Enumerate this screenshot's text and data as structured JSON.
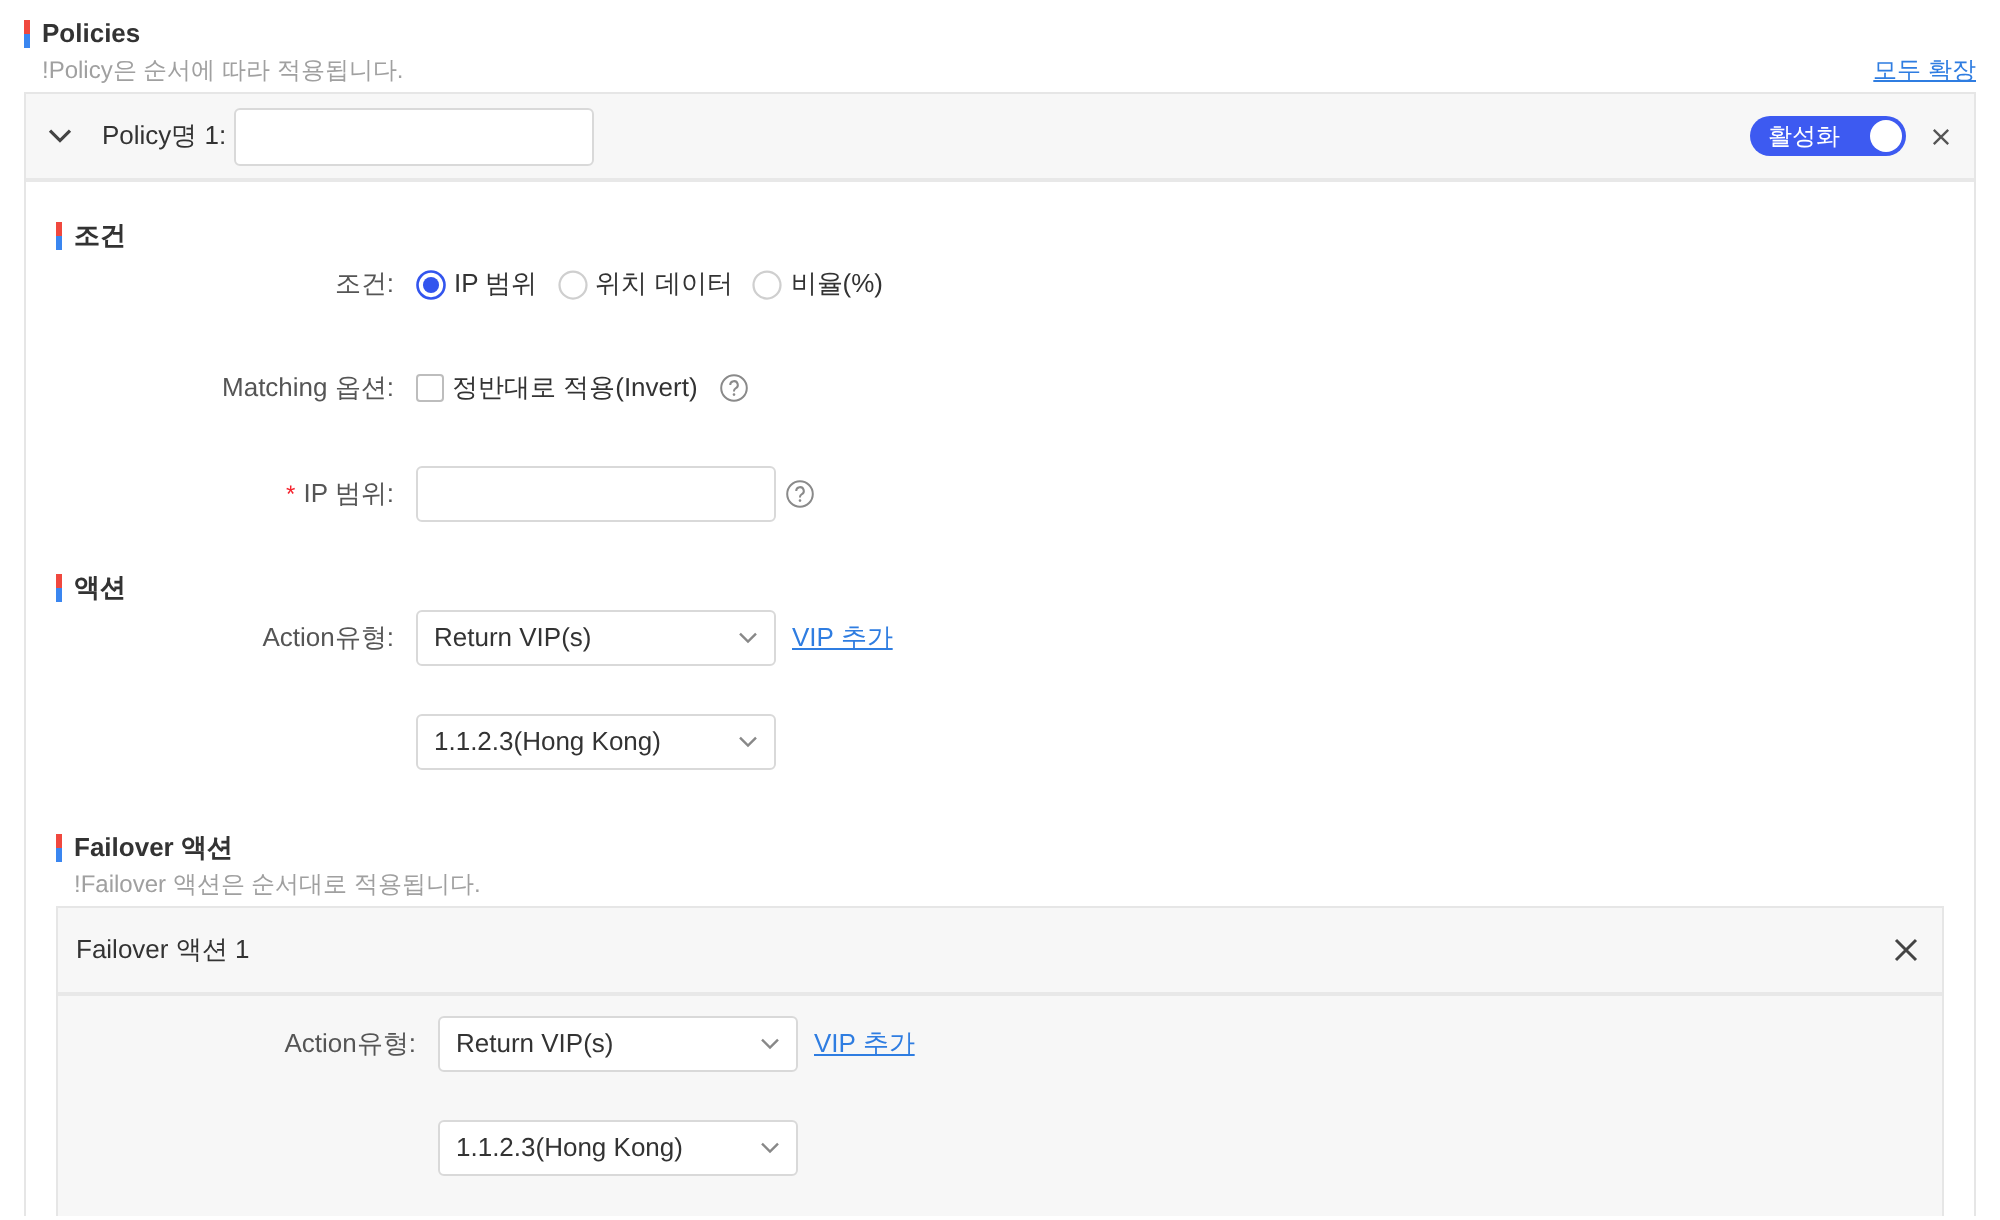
{
  "section": {
    "title": "Policies",
    "note": "!Policy은 순서에 따라 적용됩니다.",
    "expand_all_link": "모두 확장"
  },
  "policies": [
    {
      "expanded": true,
      "name_label": "Policy명 1:",
      "toggle": {
        "label": "활성화",
        "on": true
      },
      "condition": {
        "title": "조건",
        "condition_field": {
          "label": "조건:",
          "options": [
            {
              "label": "IP 범위",
              "selected": true
            },
            {
              "label": "위치 데이터",
              "selected": false
            },
            {
              "label": "비율(%)",
              "selected": false
            }
          ]
        },
        "matching_field": {
          "label": "Matching 옵션:",
          "checkbox": {
            "label": "정반대로 적용(Invert)",
            "checked": false
          },
          "help": true
        },
        "ip_range_field": {
          "required_mark": "*",
          "label": "IP 범위:",
          "help": true
        }
      },
      "action": {
        "title": "액션",
        "action_type_field": {
          "label": "Action유형:",
          "value": "Return VIP(s)"
        },
        "add_vip_link": "VIP 추가",
        "vip_select": {
          "value": "1.1.2.3(Hong Kong)"
        }
      },
      "failover": {
        "title": "Failover 액션",
        "note": "!Failover 액션은 순서대로 적용됩니다.",
        "actions": [
          {
            "title": "Failover 액션 1",
            "action_type_field": {
              "label": "Action유형:",
              "value": "Return VIP(s)"
            },
            "add_vip_link": "VIP 추가",
            "vip_select": {
              "value": "1.1.2.3(Hong Kong)"
            }
          }
        ]
      }
    }
  ]
}
